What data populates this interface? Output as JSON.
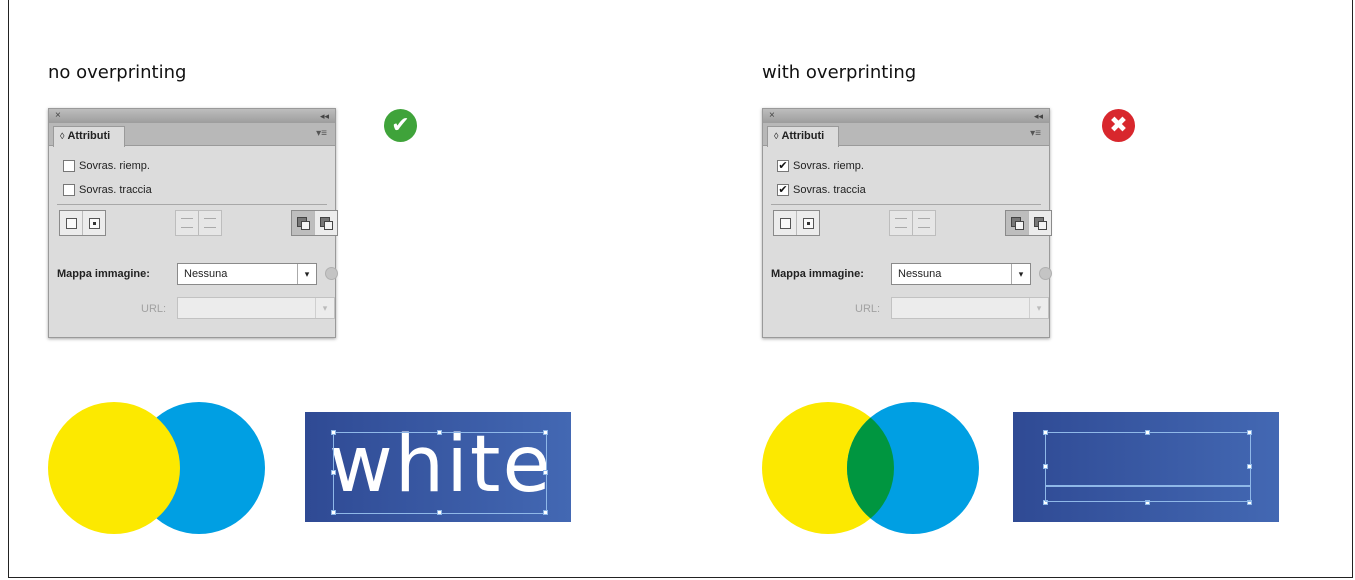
{
  "left": {
    "heading": "no overprinting",
    "panel": {
      "tab_label": "Attributi",
      "fill_overprint": {
        "label": "Sovras. riemp.",
        "checked": false
      },
      "stroke_overprint": {
        "label": "Sovras. traccia",
        "checked": false
      },
      "image_map_label": "Mappa immagine:",
      "image_map_value": "Nessuna",
      "url_label": "URL:"
    },
    "status": {
      "icon": "check-icon",
      "glyph": "✔",
      "color": "#3fa33a"
    },
    "text_sample": "white",
    "colors": {
      "yellow": "#fce900",
      "blue": "#009fe3"
    }
  },
  "right": {
    "heading": "with overprinting",
    "panel": {
      "tab_label": "Attributi",
      "fill_overprint": {
        "label": "Sovras. riemp.",
        "checked": true
      },
      "stroke_overprint": {
        "label": "Sovras. traccia",
        "checked": true
      },
      "image_map_label": "Mappa immagine:",
      "image_map_value": "Nessuna",
      "url_label": "URL:"
    },
    "status": {
      "icon": "cross-icon",
      "glyph": "✖",
      "color": "#d8272d"
    },
    "colors": {
      "yellow": "#fce900",
      "blue": "#009fe3",
      "overlap": "#009640"
    }
  },
  "icons": {
    "close": "×",
    "collapse": "◂◂",
    "panel_menu": "▾≡",
    "tab_arrow": "◊",
    "dropdown": "▾",
    "check": "✔"
  }
}
